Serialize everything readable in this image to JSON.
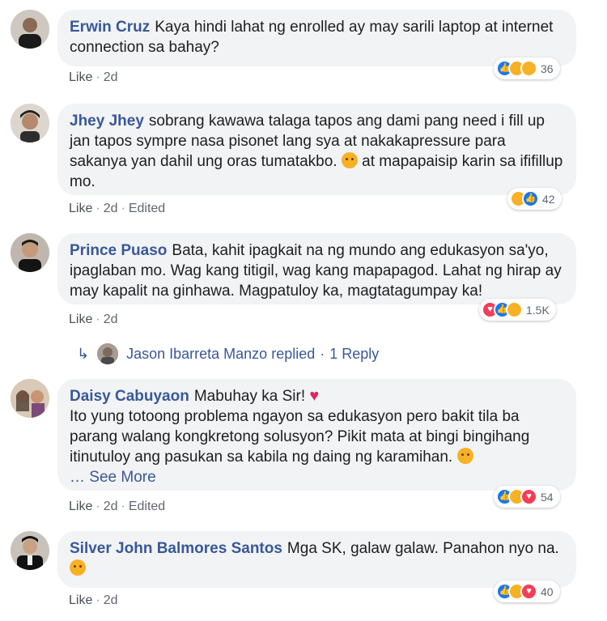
{
  "comments": [
    {
      "author": "Erwin Cruz",
      "text": "Kaya hindi lahat ng enrolled ay may sarili laptop at internet connection sa bahay?",
      "actions": {
        "like": "Like",
        "time": "2d"
      },
      "reactions": {
        "icons": [
          "like-icon",
          "sad-icon",
          "haha-icon"
        ],
        "count": "36"
      }
    },
    {
      "author": "Jhey Jhey",
      "text": "sobrang kawawa talaga tapos ang dami pang need i fill up jan tapos sympre nasa pisonet lang sya at nakakapressure para sakanya yan dahil ung oras tumatakbo.",
      "text_after_emoji": "at mapapaisip karin sa ififillup mo.",
      "actions": {
        "like": "Like",
        "time": "2d",
        "edited": "Edited"
      },
      "reactions": {
        "icons": [
          "sad-icon",
          "like-icon"
        ],
        "count": "42"
      }
    },
    {
      "author": "Prince Puaso",
      "text": "Bata, kahit ipagkait na ng mundo ang edukasyon sa'yo, ipaglaban mo. Wag kang titigil, wag kang mapapagod. Lahat ng hirap ay may kapalit na ginhawa. Magpatuloy ka, magtatagumpay ka!",
      "actions": {
        "like": "Like",
        "time": "2d"
      },
      "reactions": {
        "icons": [
          "love-icon",
          "like-icon",
          "care-icon"
        ],
        "count": "1.5K"
      },
      "reply": {
        "name": "Jason Ibarreta Manzo",
        "verb": "replied",
        "count": "1 Reply"
      }
    },
    {
      "author": "Daisy Cabuyaon",
      "text": "Mabuhay ka Sir!",
      "text2": "Ito yung totoong problema ngayon sa edukasyon pero bakit tila ba parang walang kongkretong solusyon? Pikit mata at bingi bingihang itinutuloy ang pasukan sa kabila ng daing ng karamihan.",
      "see_more": "… See More",
      "actions": {
        "like": "Like",
        "time": "2d",
        "edited": "Edited"
      },
      "reactions": {
        "icons": [
          "like-icon",
          "sad-icon",
          "love-icon"
        ],
        "count": "54"
      }
    },
    {
      "author": "Silver John Balmores Santos",
      "text": "Mga SK, galaw galaw. Panahon nyo na.",
      "actions": {
        "like": "Like",
        "time": "2d"
      },
      "reactions": {
        "icons": [
          "like-icon",
          "haha-icon",
          "love-icon"
        ],
        "count": "40"
      }
    }
  ],
  "separator": "·",
  "colors": {
    "author": "#385898",
    "bubble": "#f2f3f5",
    "like": "#1877f2",
    "love": "#f33e58",
    "emoji": "#f7b125"
  }
}
